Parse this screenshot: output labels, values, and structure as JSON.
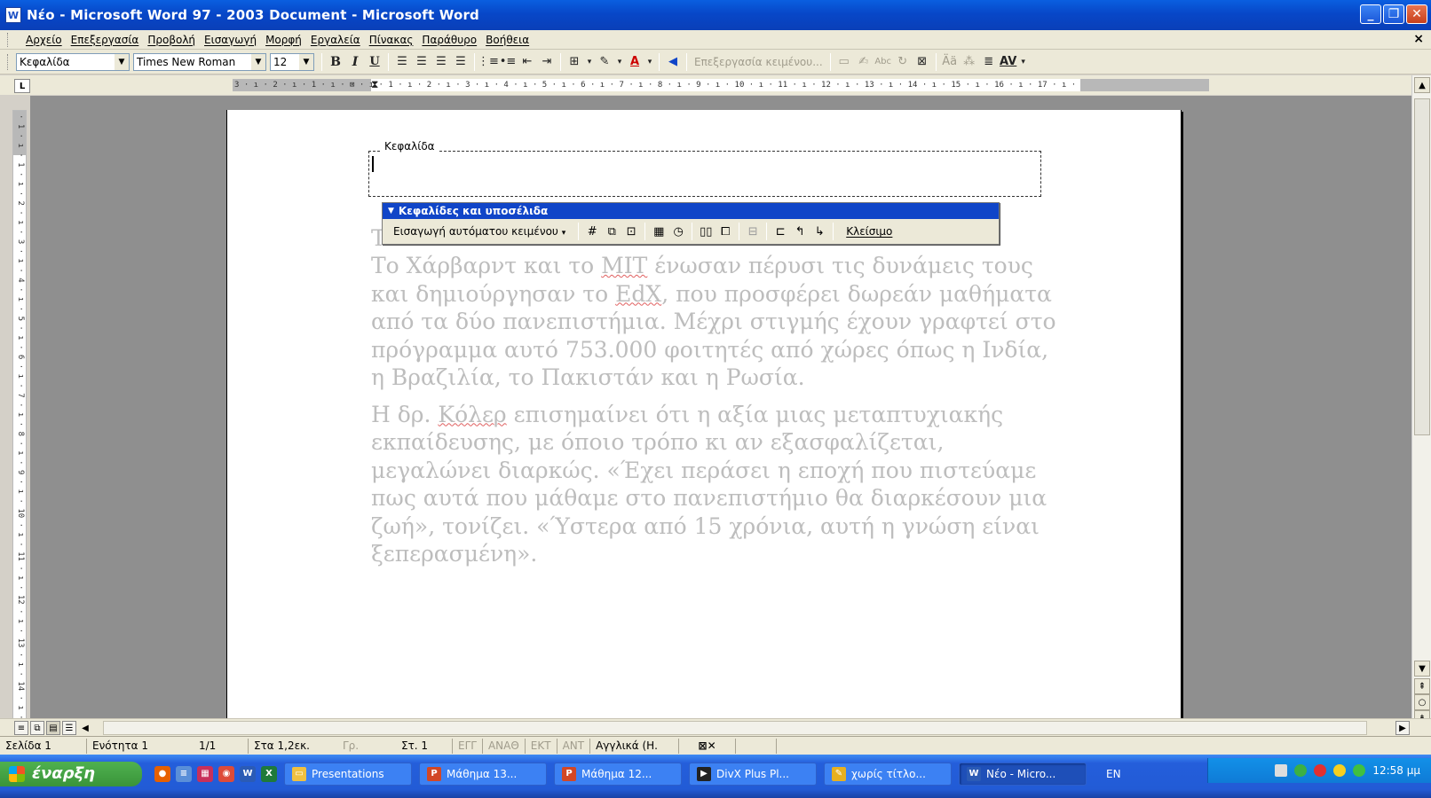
{
  "window": {
    "title": "Νέο - Microsoft Word 97 - 2003 Document - Microsoft Word",
    "app_icon": "W",
    "controls": {
      "minimize": "_",
      "maximize": "❐",
      "close": "✕"
    }
  },
  "menu": {
    "items": [
      "Αρχείο",
      "Επεξεργασία",
      "Προβολή",
      "Εισαγωγή",
      "Μορφή",
      "Εργαλεία",
      "Πίνακας",
      "Παράθυρο",
      "Βοήθεια"
    ],
    "close_doc": "×"
  },
  "toolbar": {
    "style": "Κεφαλίδα",
    "font": "Times New Roman",
    "size": "12",
    "bold": "B",
    "italic": "I",
    "underline": "U",
    "edit_text": "Επεξεργασία κειμένου..."
  },
  "ruler": {
    "ticks": "3 · ı · 2 · ı · 1 · ı · ⊠ · ı · 1 · ı · 2 · ı · 3 · ı · 4 · ı · 5 · ı · 6 · ı · 7 · ı · 8 · ı · 9 · ı · 10 · ı · 11 · ı · 12 · ı · 13 · ı · 14 · ı · 15 · ı · 16 · ı · 17 · ı ·",
    "tab_selector": "L",
    "vertical_ticks": "· 1 · ı · 1 · ı · 2 · ı · 3 · ı · 4 · ı · 5 · ı · 6 · ı · 7 · ı · 8 · ı · 9 · ı · 10 · ı · 11 · ı · 12 · ı · 13 · ı · 14 · ı · 15 · ı · 16 ·"
  },
  "document": {
    "header_label": "Κεφαλίδα",
    "peek_char": "T",
    "paragraph1": {
      "before_mit": "Το Χάρβαρντ και το ",
      "mit": "MIT",
      "after_mit": " ένωσαν πέρυσι τις δυνάμεις τους και δημιούργησαν το ",
      "edx": "EdX",
      "rest": ", που προσφέρει δωρεάν μαθήματα από τα δύο πανεπιστήμια. Μέχρι στιγμής έχουν γραφτεί στο πρόγραμμα αυτό 753.000 φοιτητές από χώρες όπως η Ινδία, η Βραζιλία, το Πακιστάν και η Ρωσία."
    },
    "paragraph2": {
      "before": "Η δρ. ",
      "koler": "Κόλερ",
      "rest": " επισημαίνει ότι η αξία μιας μεταπτυχιακής εκπαίδευσης, με όποιο τρόπο κι αν εξασφαλίζεται, μεγαλώνει διαρκώς. «Έχει περάσει η εποχή που πιστεύαμε πως αυτά που μάθαμε στο πανεπιστήμιο θα διαρκέσουν μια ζωή», τονίζει. «Ύστερα από 15 χρόνια, αυτή η γνώση είναι ξεπερασμένη»."
    }
  },
  "hf_toolbar": {
    "title": "Κεφαλίδες και υποσέλιδα",
    "autotext": "Εισαγωγή αυτόματου κειμένου",
    "close": "Κλείσιμο"
  },
  "status": {
    "page": "Σελίδα 1",
    "section": "Ενότητα 1",
    "pages": "1/1",
    "at": "Στα 1,2εκ.",
    "line": "Γρ.",
    "col": "Στ. 1",
    "rec": "ΕΓΓ",
    "trk": "ΑΝΑΘ",
    "ext": "ΕΚΤ",
    "ovr": "ΑΝΤ",
    "language": "Αγγλικά (Η."
  },
  "taskbar": {
    "start": "έναρξη",
    "tasks": [
      {
        "label": "Presentations",
        "icon": "folder-icon",
        "color": "#f0c040"
      },
      {
        "label": "Μάθημα 13...",
        "icon": "powerpoint-icon",
        "color": "#d24726"
      },
      {
        "label": "Μάθημα 12...",
        "icon": "powerpoint-icon",
        "color": "#d24726"
      },
      {
        "label": "DivX Plus Pl...",
        "icon": "divx-icon",
        "color": "#222222"
      },
      {
        "label": "χωρίς τίτλο...",
        "icon": "paint-icon",
        "color": "#e8b020"
      },
      {
        "label": "Νέο - Micro...",
        "icon": "word-icon",
        "color": "#2b5bb5"
      }
    ],
    "lang": "EN",
    "clock": "12:58 μμ"
  }
}
